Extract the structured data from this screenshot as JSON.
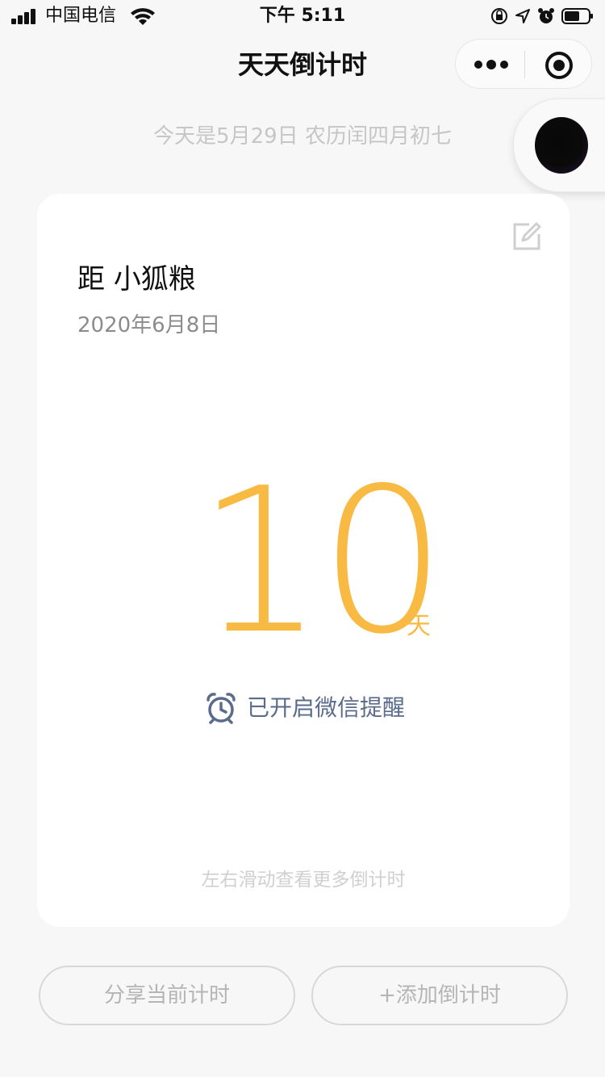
{
  "status_bar": {
    "carrier": "中国电信",
    "time": "下午 5:11"
  },
  "nav": {
    "title": "天天倒计时"
  },
  "today": {
    "text": "今天是5月29日 农历闰四月初七"
  },
  "card": {
    "title": "距 小狐粮",
    "date": "2020年6月8日",
    "count": "10",
    "unit": "天",
    "reminder": "已开启微信提醒",
    "swipe_hint": "左右滑动查看更多倒计时"
  },
  "buttons": {
    "share": "分享当前计时",
    "add": "+添加倒计时"
  },
  "colors": {
    "accent": "#f8ba43",
    "reminder": "#5a6b8c",
    "background": "#f7f7f7"
  },
  "icons": {
    "signal": "signal-icon",
    "wifi": "wifi-icon",
    "lock_rotation": "lock-rotation-icon",
    "location": "location-icon",
    "alarm": "alarm-icon",
    "battery": "battery-icon",
    "more": "more-icon",
    "close_target": "target-icon",
    "edit": "edit-icon",
    "reminder_clock": "alarm-clock-icon"
  }
}
